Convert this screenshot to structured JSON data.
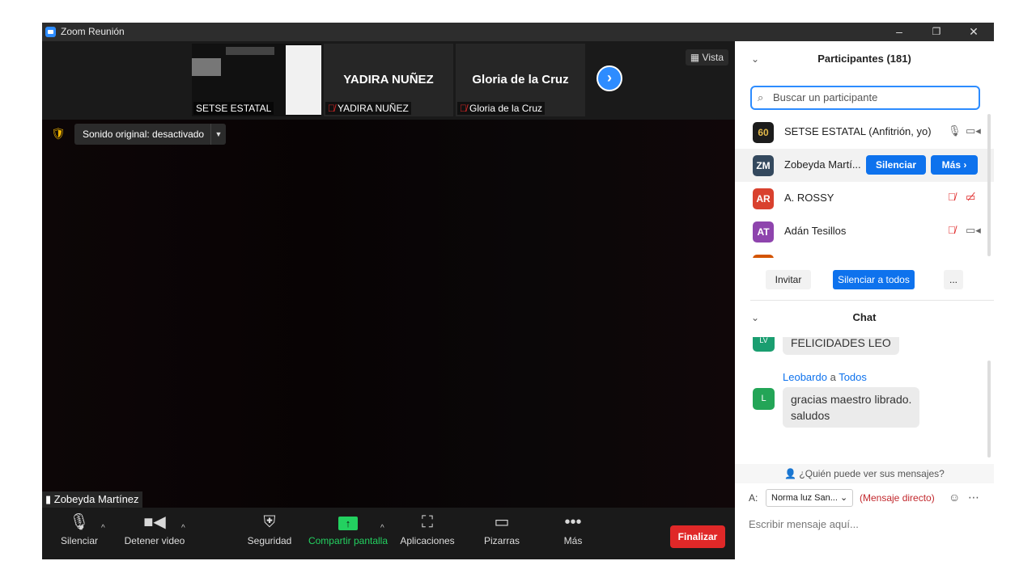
{
  "window": {
    "title": "Zoom Reunión",
    "minimize": "–",
    "restore": "❐",
    "close": "✕"
  },
  "strip": {
    "tiles": [
      {
        "name": "SETSE ESTATAL",
        "big": ""
      },
      {
        "name": "YADIRA NUÑEZ",
        "big": "YADIRA NUÑEZ"
      },
      {
        "name": "Gloria de la Cruz",
        "big": "Gloria de la Cruz"
      }
    ],
    "next": "›",
    "view_label": "Vista"
  },
  "main": {
    "sound_label": "Sonido original: desactivado",
    "speaker": "Zobeyda Martínez"
  },
  "toolbar": {
    "mute": "Silenciar",
    "video": "Detener video",
    "security": "Seguridad",
    "share": "Compartir pantalla",
    "apps": "Aplicaciones",
    "whiteboards": "Pizarras",
    "more": "Más",
    "end": "Finalizar"
  },
  "participants": {
    "header": "Participantes (181)",
    "search_placeholder": "Buscar un participante",
    "rows": [
      {
        "initials": "60",
        "name": "SETSE ESTATAL (Anfitrión, yo)",
        "color": "#1c1c1c"
      },
      {
        "initials": "ZM",
        "name": "Zobeyda Martí...",
        "color": "#34495e"
      },
      {
        "initials": "AR",
        "name": "A. ROSSY",
        "color": "#d9412e"
      },
      {
        "initials": "AT",
        "name": "Adán Tesillos",
        "color": "#8e44ad"
      }
    ],
    "mute_btn": "Silenciar",
    "more_btn": "Más ›",
    "invite": "Invitar",
    "mute_all": "Silenciar a todos",
    "more_dots": "..."
  },
  "chat": {
    "header": "Chat",
    "messages": [
      {
        "avatar": "LV",
        "text": "FELICIDADES LEO"
      },
      {
        "avatar": "L",
        "sender": "Leobardo",
        "to_word": "a",
        "to": "Todos",
        "text_line1": "gracias maestro librado.",
        "text_line2": "saludos"
      }
    ],
    "who_can_see": "¿Quién puede ver sus mensajes?",
    "to_label": "A:",
    "recipient": "Norma luz San...",
    "direct": "(Mensaje directo)",
    "input_placeholder": "Escribir mensaje aquí..."
  }
}
